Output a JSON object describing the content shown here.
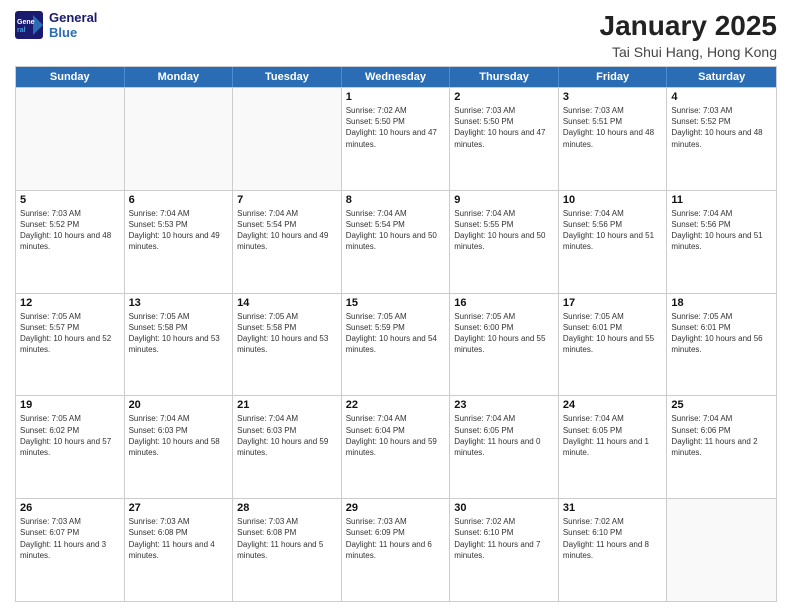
{
  "header": {
    "logo_line1": "General",
    "logo_line2": "Blue",
    "title": "January 2025",
    "subtitle": "Tai Shui Hang, Hong Kong"
  },
  "days_of_week": [
    "Sunday",
    "Monday",
    "Tuesday",
    "Wednesday",
    "Thursday",
    "Friday",
    "Saturday"
  ],
  "weeks": [
    [
      {
        "day": "",
        "empty": true
      },
      {
        "day": "",
        "empty": true
      },
      {
        "day": "",
        "empty": true
      },
      {
        "day": "1",
        "sunrise": "7:02 AM",
        "sunset": "5:50 PM",
        "daylight": "10 hours and 47 minutes."
      },
      {
        "day": "2",
        "sunrise": "7:03 AM",
        "sunset": "5:50 PM",
        "daylight": "10 hours and 47 minutes."
      },
      {
        "day": "3",
        "sunrise": "7:03 AM",
        "sunset": "5:51 PM",
        "daylight": "10 hours and 48 minutes."
      },
      {
        "day": "4",
        "sunrise": "7:03 AM",
        "sunset": "5:52 PM",
        "daylight": "10 hours and 48 minutes."
      }
    ],
    [
      {
        "day": "5",
        "sunrise": "7:03 AM",
        "sunset": "5:52 PM",
        "daylight": "10 hours and 48 minutes."
      },
      {
        "day": "6",
        "sunrise": "7:04 AM",
        "sunset": "5:53 PM",
        "daylight": "10 hours and 49 minutes."
      },
      {
        "day": "7",
        "sunrise": "7:04 AM",
        "sunset": "5:54 PM",
        "daylight": "10 hours and 49 minutes."
      },
      {
        "day": "8",
        "sunrise": "7:04 AM",
        "sunset": "5:54 PM",
        "daylight": "10 hours and 50 minutes."
      },
      {
        "day": "9",
        "sunrise": "7:04 AM",
        "sunset": "5:55 PM",
        "daylight": "10 hours and 50 minutes."
      },
      {
        "day": "10",
        "sunrise": "7:04 AM",
        "sunset": "5:56 PM",
        "daylight": "10 hours and 51 minutes."
      },
      {
        "day": "11",
        "sunrise": "7:04 AM",
        "sunset": "5:56 PM",
        "daylight": "10 hours and 51 minutes."
      }
    ],
    [
      {
        "day": "12",
        "sunrise": "7:05 AM",
        "sunset": "5:57 PM",
        "daylight": "10 hours and 52 minutes."
      },
      {
        "day": "13",
        "sunrise": "7:05 AM",
        "sunset": "5:58 PM",
        "daylight": "10 hours and 53 minutes."
      },
      {
        "day": "14",
        "sunrise": "7:05 AM",
        "sunset": "5:58 PM",
        "daylight": "10 hours and 53 minutes."
      },
      {
        "day": "15",
        "sunrise": "7:05 AM",
        "sunset": "5:59 PM",
        "daylight": "10 hours and 54 minutes."
      },
      {
        "day": "16",
        "sunrise": "7:05 AM",
        "sunset": "6:00 PM",
        "daylight": "10 hours and 55 minutes."
      },
      {
        "day": "17",
        "sunrise": "7:05 AM",
        "sunset": "6:01 PM",
        "daylight": "10 hours and 55 minutes."
      },
      {
        "day": "18",
        "sunrise": "7:05 AM",
        "sunset": "6:01 PM",
        "daylight": "10 hours and 56 minutes."
      }
    ],
    [
      {
        "day": "19",
        "sunrise": "7:05 AM",
        "sunset": "6:02 PM",
        "daylight": "10 hours and 57 minutes."
      },
      {
        "day": "20",
        "sunrise": "7:04 AM",
        "sunset": "6:03 PM",
        "daylight": "10 hours and 58 minutes."
      },
      {
        "day": "21",
        "sunrise": "7:04 AM",
        "sunset": "6:03 PM",
        "daylight": "10 hours and 59 minutes."
      },
      {
        "day": "22",
        "sunrise": "7:04 AM",
        "sunset": "6:04 PM",
        "daylight": "10 hours and 59 minutes."
      },
      {
        "day": "23",
        "sunrise": "7:04 AM",
        "sunset": "6:05 PM",
        "daylight": "11 hours and 0 minutes."
      },
      {
        "day": "24",
        "sunrise": "7:04 AM",
        "sunset": "6:05 PM",
        "daylight": "11 hours and 1 minute."
      },
      {
        "day": "25",
        "sunrise": "7:04 AM",
        "sunset": "6:06 PM",
        "daylight": "11 hours and 2 minutes."
      }
    ],
    [
      {
        "day": "26",
        "sunrise": "7:03 AM",
        "sunset": "6:07 PM",
        "daylight": "11 hours and 3 minutes."
      },
      {
        "day": "27",
        "sunrise": "7:03 AM",
        "sunset": "6:08 PM",
        "daylight": "11 hours and 4 minutes."
      },
      {
        "day": "28",
        "sunrise": "7:03 AM",
        "sunset": "6:08 PM",
        "daylight": "11 hours and 5 minutes."
      },
      {
        "day": "29",
        "sunrise": "7:03 AM",
        "sunset": "6:09 PM",
        "daylight": "11 hours and 6 minutes."
      },
      {
        "day": "30",
        "sunrise": "7:02 AM",
        "sunset": "6:10 PM",
        "daylight": "11 hours and 7 minutes."
      },
      {
        "day": "31",
        "sunrise": "7:02 AM",
        "sunset": "6:10 PM",
        "daylight": "11 hours and 8 minutes."
      },
      {
        "day": "",
        "empty": true
      }
    ]
  ],
  "labels": {
    "sunrise_prefix": "Sunrise: ",
    "sunset_prefix": "Sunset: ",
    "daylight_prefix": "Daylight: "
  }
}
